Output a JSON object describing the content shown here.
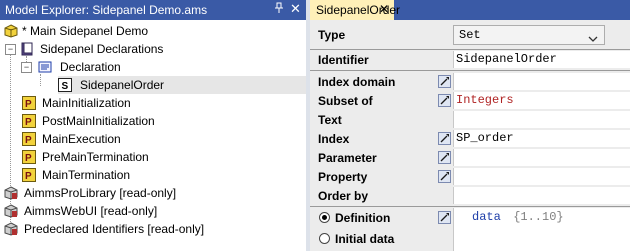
{
  "left_pane": {
    "title": "Model Explorer: Sidepanel Demo.ams",
    "pin_icon": "pin-icon",
    "close_glyph": "✕",
    "tree": [
      {
        "label": "* Main Sidepanel Demo",
        "icon": "model-icon"
      },
      {
        "label": "Sidepanel Declarations",
        "icon": "book-icon"
      },
      {
        "label": "Declaration",
        "icon": "declaration-icon"
      },
      {
        "label": "SidepanelOrder",
        "icon": "set-s-icon"
      },
      {
        "label": "MainInitialization",
        "icon": "procedure-p-icon"
      },
      {
        "label": "PostMainInitialization",
        "icon": "procedure-p-icon"
      },
      {
        "label": "MainExecution",
        "icon": "procedure-p-icon"
      },
      {
        "label": "PreMainTermination",
        "icon": "procedure-p-icon"
      },
      {
        "label": "MainTermination",
        "icon": "procedure-p-icon"
      },
      {
        "label": "AimmsProLibrary [read-only]",
        "icon": "library-icon"
      },
      {
        "label": "AimmsWebUI [read-only]",
        "icon": "library-icon"
      },
      {
        "label": "Predeclared Identifiers [read-only]",
        "icon": "library-icon"
      }
    ]
  },
  "right_pane": {
    "tab_label": "SidepanelOrder",
    "tab_close": "✕",
    "type_label": "Type",
    "type_value": "Set",
    "identifier_label": "Identifier",
    "identifier_value": "SidepanelOrder",
    "attributes": [
      {
        "label": "Index domain",
        "value": ""
      },
      {
        "label": "Subset of",
        "value": "Integers"
      },
      {
        "label": "Text",
        "value": ""
      },
      {
        "label": "Index",
        "value": "SP_order"
      },
      {
        "label": "Parameter",
        "value": ""
      },
      {
        "label": "Property",
        "value": ""
      },
      {
        "label": "Order by",
        "value": ""
      }
    ],
    "definition_radio": "Definition",
    "initial_data_radio": "Initial data",
    "definition_value": {
      "keyword": "data",
      "body": " {1..10}"
    }
  },
  "colors": {
    "title_bar": "#3a5aa6",
    "active_tab": "#fff0b8",
    "keyword": "#1e3ea8",
    "identifier_red": "#b02424",
    "comment_gray": "#808080"
  }
}
